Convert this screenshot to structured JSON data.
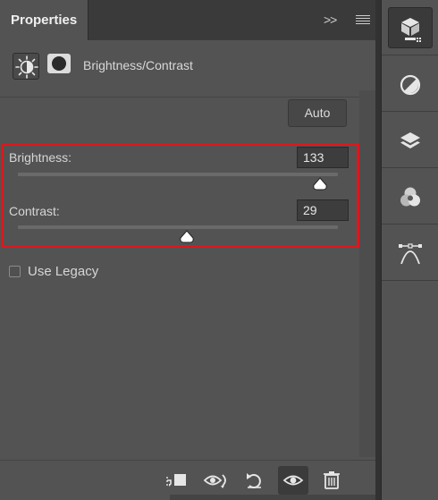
{
  "panel": {
    "tab_title": "Properties",
    "collapse_glyph": ">>"
  },
  "adjustment": {
    "title": "Brightness/Contrast"
  },
  "auto_button": "Auto",
  "sliders": {
    "brightness": {
      "label": "Brightness:",
      "value": "133",
      "min": -150,
      "max": 150
    },
    "contrast": {
      "label": "Contrast:",
      "value": "29",
      "min": -50,
      "max": 100
    }
  },
  "legacy": {
    "label": "Use Legacy",
    "checked": false
  },
  "footer_icons": [
    "clip-to-layer-icon",
    "view-previous-state-icon",
    "reset-icon",
    "toggle-visibility-icon",
    "delete-icon"
  ],
  "right_toolbar_icons": [
    "properties-icon",
    "adjustments-icon",
    "layers-icon",
    "channels-icon",
    "paths-icon"
  ],
  "colors": {
    "panel_bg": "#535353",
    "highlight": "#e0161b",
    "thumb": "#ffffff"
  }
}
